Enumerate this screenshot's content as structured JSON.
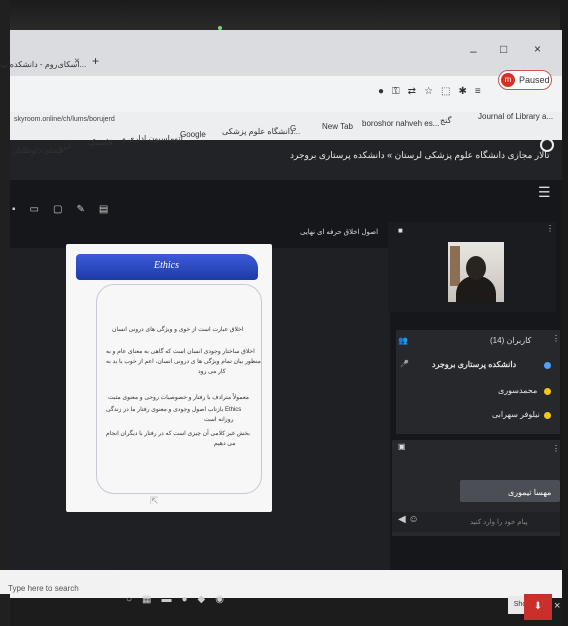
{
  "browser": {
    "tab_title": "اسکای‌روم - دانشکده پ...",
    "new_tab": "+",
    "url": "skyroom.online/ch/lums/borujerd",
    "paused_avatar": "m",
    "paused_label": "Paused",
    "window_controls": [
      "–",
      "□",
      "×"
    ],
    "bookmarks": [
      {
        "label": "فضای داوطلبان"
      },
      {
        "label": "ایزد"
      },
      {
        "label": "قاصدک"
      },
      {
        "label": "اتوماسیون اداری و..."
      },
      {
        "label": "Google"
      },
      {
        "label": "دانشگاه علوم پزشکی..."
      },
      {
        "label": "G"
      },
      {
        "label": "New Tab"
      },
      {
        "label": "boroshor nahveh es..."
      },
      {
        "label": "گنج"
      },
      {
        "label": "Journal of Library a..."
      }
    ]
  },
  "app": {
    "title": "تالار مجازی دانشگاه علوم پزشکی لرستان » دانشکده پرستاری بروجرد",
    "menu_icon": "☰"
  },
  "presentation": {
    "header": "اصول اخلاق حرفه ای نهایی",
    "slide_title": "Ethics",
    "bullets": [
      "اخلاق عبارت است از خوی و ویژگی های درونی انسان",
      "اخلاق ساختار وجودی انسان است که گاهی به معنای عام و به",
      "منظور بیان تمام ویژگی ها ی درونی انسان، اعم از خوب یا بد به",
      "کار می رود",
      "معمولاً مترادف با رفتار و خصوصیات روحی و معنوی مثبت",
      "Ethics بازتاب اصول وجودی و معنوی رفتار ما در زندگی",
      "روزانه است",
      "بخش غیر کلامی آن چیزی است که در رفتار با دیگران انجام",
      "می دهیم"
    ]
  },
  "users": {
    "header": "کاربران (14)",
    "list": [
      {
        "name": "دانشکده پرستاری بروجرد",
        "color": "#4fa3ff"
      },
      {
        "name": "محمدسوری",
        "color": "#f5c518"
      },
      {
        "name": "نیلوفر سهرابی",
        "color": "#f5c518"
      }
    ]
  },
  "chat": {
    "last_sender": "مهسا تیموری",
    "placeholder": "پیام خود را وارد کنید"
  },
  "os": {
    "download_item": "",
    "search_placeholder": "Type here to search",
    "show_all": "Sho"
  }
}
